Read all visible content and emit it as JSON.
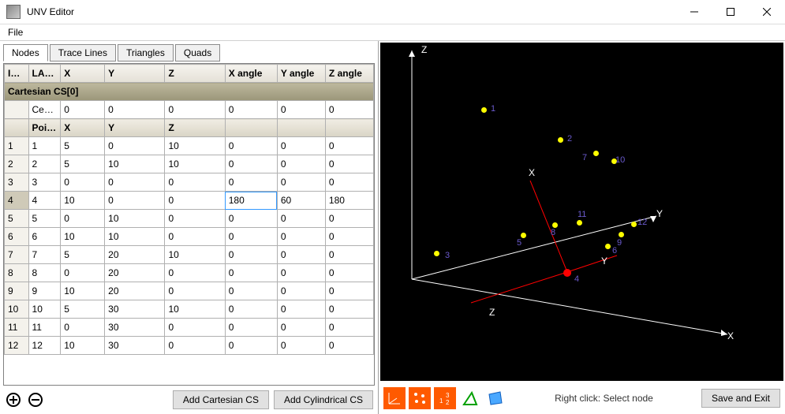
{
  "window": {
    "title": "UNV Editor",
    "min_tooltip": "Minimize",
    "max_tooltip": "Maximize",
    "close_tooltip": "Close"
  },
  "menu": {
    "file": "File"
  },
  "tabs": [
    "Nodes",
    "Trace Lines",
    "Triangles",
    "Quads"
  ],
  "activeTab": 0,
  "columns": [
    "IN…",
    "LA…",
    "X",
    "Y",
    "Z",
    "X angle",
    "Y angle",
    "Z angle"
  ],
  "csLabel": "Cartesian CS[0]",
  "centerRow": {
    "label": "Center …",
    "vals": [
      "0",
      "0",
      "0",
      "0",
      "0",
      "0"
    ]
  },
  "pointsHeader": [
    "Points",
    "X",
    "Y",
    "Z"
  ],
  "rows": [
    {
      "idx": "1",
      "label": "1",
      "x": "5",
      "y": "0",
      "z": "10",
      "ax": "0",
      "ay": "0",
      "az": "0"
    },
    {
      "idx": "2",
      "label": "2",
      "x": "5",
      "y": "10",
      "z": "10",
      "ax": "0",
      "ay": "0",
      "az": "0"
    },
    {
      "idx": "3",
      "label": "3",
      "x": "0",
      "y": "0",
      "z": "0",
      "ax": "0",
      "ay": "0",
      "az": "0"
    },
    {
      "idx": "4",
      "label": "4",
      "x": "10",
      "y": "0",
      "z": "0",
      "ax": "180",
      "ay": "60",
      "az": "180"
    },
    {
      "idx": "5",
      "label": "5",
      "x": "0",
      "y": "10",
      "z": "0",
      "ax": "0",
      "ay": "0",
      "az": "0"
    },
    {
      "idx": "6",
      "label": "6",
      "x": "10",
      "y": "10",
      "z": "0",
      "ax": "0",
      "ay": "0",
      "az": "0"
    },
    {
      "idx": "7",
      "label": "7",
      "x": "5",
      "y": "20",
      "z": "10",
      "ax": "0",
      "ay": "0",
      "az": "0"
    },
    {
      "idx": "8",
      "label": "8",
      "x": "0",
      "y": "20",
      "z": "0",
      "ax": "0",
      "ay": "0",
      "az": "0"
    },
    {
      "idx": "9",
      "label": "9",
      "x": "10",
      "y": "20",
      "z": "0",
      "ax": "0",
      "ay": "0",
      "az": "0"
    },
    {
      "idx": "10",
      "label": "10",
      "x": "5",
      "y": "30",
      "z": "10",
      "ax": "0",
      "ay": "0",
      "az": "0"
    },
    {
      "idx": "11",
      "label": "11",
      "x": "0",
      "y": "30",
      "z": "0",
      "ax": "0",
      "ay": "0",
      "az": "0"
    },
    {
      "idx": "12",
      "label": "12",
      "x": "10",
      "y": "30",
      "z": "0",
      "ax": "0",
      "ay": "0",
      "az": "0"
    }
  ],
  "selectedRow": 3,
  "editCell": {
    "row": 3,
    "col": "ax",
    "value": "180"
  },
  "buttons": {
    "addCartesian": "Add Cartesian CS",
    "addCylindrical": "Add Cylindrical CS",
    "saveExit": "Save and Exit"
  },
  "viewerHint": "Right click: Select node",
  "axisLabels": {
    "x": "X",
    "y": "Y",
    "z": "Z"
  }
}
